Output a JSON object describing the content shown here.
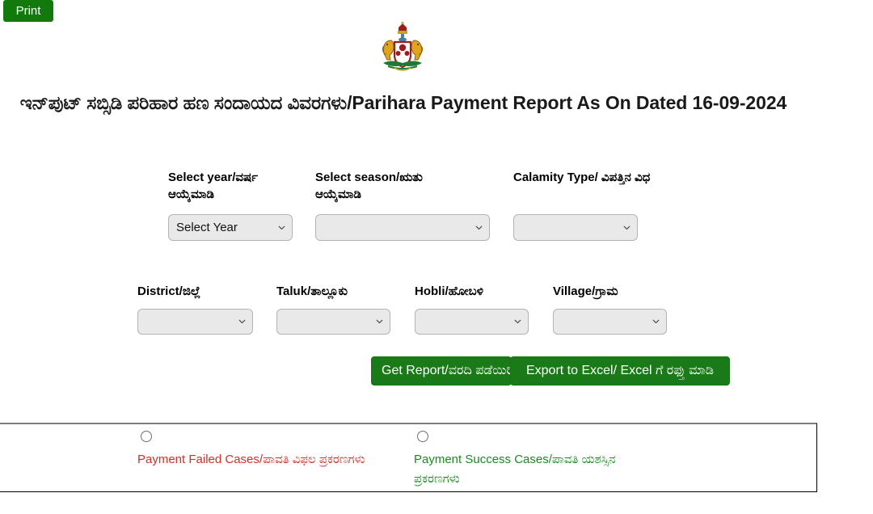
{
  "toolbar": {
    "print_label": "Print"
  },
  "header": {
    "emblem_name": "karnataka-state-emblem",
    "title": "ಇನ್‌ಪುಟ್ ಸಬ್ಸಿಡಿ ಪರಿಹಾರ ಹಣ ಸಂದಾಯದ ವಿವರಗಳು/Parihara Payment Report As On Dated 16-09-2024"
  },
  "form": {
    "row1": [
      {
        "label": "Select year/ವರ್ಷ ಆಯ್ಕೆಮಾಡಿ",
        "value": "Select Year",
        "name": "select-year"
      },
      {
        "label": "Select season/ಋತು ಆಯ್ಕೆಮಾಡಿ",
        "value": "",
        "name": "select-season"
      },
      {
        "label": "Calamity Type/ ವಿಪತ್ತಿನ ವಿಧ",
        "value": "",
        "name": "calamity-type"
      }
    ],
    "row2": [
      {
        "label": "District/ಜಿಲ್ಲೆ",
        "value": "",
        "name": "district"
      },
      {
        "label": "Taluk/ತಾಲ್ಲೂಕು",
        "value": "",
        "name": "taluk"
      },
      {
        "label": "Hobli/ಹೋಬಳಿ",
        "value": "",
        "name": "hobli"
      },
      {
        "label": "Village/ಗ್ರಾಮ",
        "value": "",
        "name": "village"
      }
    ]
  },
  "actions": {
    "get_report_label": "Get Report/ವರದಿ ಪಡೆಯಿರಿ",
    "export_excel_label": "Export to Excel/ Excel ಗೆ ರಫ್ತು ಮಾಡಿ"
  },
  "options": {
    "failed_label": "Payment Failed Cases/ಪಾವತಿ ವಿಫಲ ಪ್ರಕರಣಗಳು",
    "success_label": "Payment Success Cases/ಪಾವತಿ ಯಶಸ್ಸಿನ ಪ್ರಕರಣಗಳು"
  },
  "colors": {
    "button_green": "#1a7a18",
    "print_green": "#127a0c",
    "failed_red": "#d03027",
    "success_green": "#1a8a21",
    "dropdown_bg": "#e9e9e9"
  }
}
